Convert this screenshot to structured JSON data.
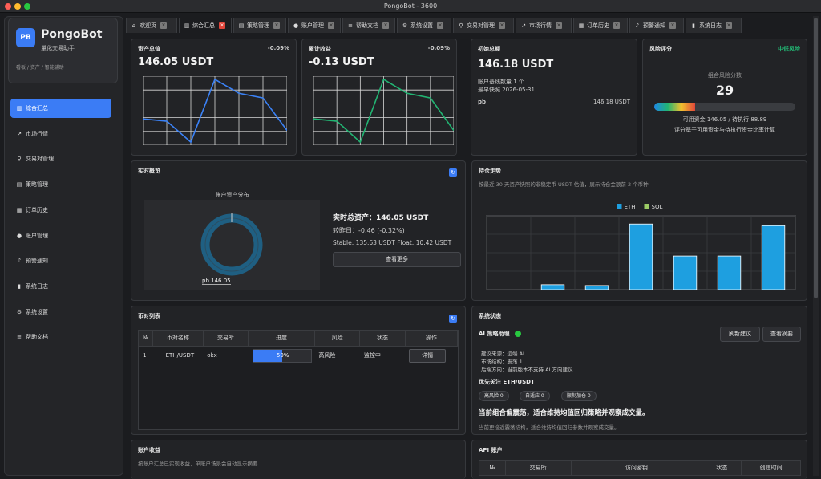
{
  "window": {
    "title": "PongoBot - 3600"
  },
  "brand": {
    "logo": "PB",
    "name": "PongoBot",
    "subtitle": "量化交易助手",
    "tags": "看板 / 资产 / 智能辅助"
  },
  "sidebar": {
    "items": [
      {
        "label": "综合汇总",
        "icon": "chart-icon",
        "glyph": "▥",
        "active": true
      },
      {
        "label": "市场行情",
        "icon": "trend-icon",
        "glyph": "↗"
      },
      {
        "label": "交易对管理",
        "icon": "magnifier-icon",
        "glyph": "⚲"
      },
      {
        "label": "策略管理",
        "icon": "notepad-icon",
        "glyph": "▤"
      },
      {
        "label": "订单历史",
        "icon": "clipboard-icon",
        "glyph": "▦"
      },
      {
        "label": "账户管理",
        "icon": "user-icon",
        "glyph": "●"
      },
      {
        "label": "预警通知",
        "icon": "bell-icon",
        "glyph": "♪"
      },
      {
        "label": "系统日志",
        "icon": "book-icon",
        "glyph": "▮"
      },
      {
        "label": "系统设置",
        "icon": "gear-icon",
        "glyph": "⚙"
      },
      {
        "label": "帮助文档",
        "icon": "books-icon",
        "glyph": "≡"
      }
    ]
  },
  "tabs": [
    {
      "label": "欢迎页",
      "icon": "home-icon",
      "glyph": "⌂"
    },
    {
      "label": "综合汇总",
      "icon": "chart-icon",
      "glyph": "▥",
      "active": true
    },
    {
      "label": "策略管理",
      "icon": "notepad-icon",
      "glyph": "▤"
    },
    {
      "label": "账户管理",
      "icon": "user-icon",
      "glyph": "●"
    },
    {
      "label": "帮助文档",
      "icon": "books-icon",
      "glyph": "≡"
    },
    {
      "label": "系统设置",
      "icon": "gear-icon",
      "glyph": "⚙"
    },
    {
      "label": "交易对管理",
      "icon": "magnifier-icon",
      "glyph": "⚲"
    },
    {
      "label": "市场行情",
      "icon": "trend-icon",
      "glyph": "↗"
    },
    {
      "label": "订单历史",
      "icon": "clipboard-icon",
      "glyph": "▦"
    },
    {
      "label": "预警通知",
      "icon": "bell-icon",
      "glyph": "♪"
    },
    {
      "label": "系统日志",
      "icon": "book-icon",
      "glyph": "▮"
    }
  ],
  "asset_card": {
    "title": "资产总值",
    "change": "-0.09%",
    "value": "146.05 USDT"
  },
  "pnl_card": {
    "title": "累计收益",
    "change": "-0.09%",
    "value": "-0.13 USDT"
  },
  "initial_card": {
    "title": "初始总额",
    "value": "146.18 USDT",
    "line1": "账户基线数量 1 个",
    "line2": "最早快照 2026-05-31",
    "account": "pb",
    "account_value": "146.18 USDT"
  },
  "risk_card": {
    "title": "风险评分",
    "level": "中低风险",
    "score_label": "组合风险分数",
    "score": "29",
    "score_pct": 29,
    "line1": "可用资金 146.05 / 待执行 88.89",
    "line2": "评分基于可用资金与待执行资金比率计算"
  },
  "realtime": {
    "title": "实时概览",
    "donut_title": "账户资产分布",
    "donut_label": "pb 146.05",
    "total_label": "实时总资产：",
    "total_value": "146.05 USDT",
    "prev_label": "较昨日：",
    "prev_value": "-0.46 (-0.32%)",
    "stable_line": "Stable: 135.63 USDT   Float: 10.42 USDT",
    "more_button": "查看更多"
  },
  "holdings": {
    "title": "持仓走势",
    "subtitle": "按最近 30 天资产快照的非稳定币 USDT 估值，展示持仓金额前 2 个币种"
  },
  "pairs": {
    "title": "币对列表",
    "columns": [
      "№",
      "币对名称",
      "交易所",
      "进度",
      "风险",
      "状态",
      "操作"
    ],
    "rows": [
      {
        "no": "1",
        "pair": "ETH/USDT",
        "exchange": "okx",
        "progress": "50%",
        "progress_value": 50,
        "risk": "高风险",
        "status": "监控中",
        "action": "详情"
      }
    ]
  },
  "system": {
    "title": "系统状态",
    "ai_label": "AI 策略助理",
    "refresh_button": "刷新建议",
    "summary_button": "查看摘要",
    "lines": [
      "建议来源：远端 AI",
      "市场结构：震荡 1",
      "后端方向：当前版本不支持 AI 方向建议"
    ],
    "focus": "优先关注 ETH/USDT",
    "pills": [
      "高风险 0",
      "自适应 0",
      "限制加仓 0"
    ],
    "headline": "当前组合偏震荡，适合维持均值回归策略并观察成交量。",
    "detail": "当前更接近震荡结构，适合维持均值回归参数并观察成交量。"
  },
  "account_income": {
    "title": "账户收益",
    "subtitle": "按账户汇总已实现收益，单账户场景会自动显示摘要"
  },
  "api": {
    "title": "API 账户",
    "columns": [
      "№",
      "交易所",
      "访问密钥",
      "状态",
      "创建时间"
    ]
  },
  "chart_data": [
    {
      "type": "line",
      "title": "",
      "x": [
        1,
        2,
        3,
        4,
        5,
        6,
        7
      ],
      "series": [
        {
          "values": [
            146.1,
            146.09,
            146.0,
            146.27,
            146.21,
            146.19,
            146.05
          ]
        }
      ],
      "color": "#3b82f6",
      "grid": true
    },
    {
      "type": "line",
      "title": "",
      "x": [
        1,
        2,
        3,
        4,
        5,
        6,
        7
      ],
      "series": [
        {
          "values": [
            -0.08,
            -0.09,
            -0.18,
            0.09,
            0.03,
            0.01,
            -0.13
          ]
        }
      ],
      "color": "#22b573",
      "grid": true
    },
    {
      "type": "bar",
      "title": "",
      "categories": [
        "1",
        "2",
        "3",
        "4",
        "5",
        "6",
        "7"
      ],
      "series": [
        {
          "name": "ETH",
          "values": [
            0,
            6,
            5,
            80,
            41,
            41,
            78
          ]
        },
        {
          "name": "SOL",
          "values": [
            0,
            0,
            0,
            0,
            0,
            0,
            0
          ]
        }
      ],
      "colors": {
        "ETH": "#1e9fe0",
        "SOL": "#9ccc65"
      },
      "legend": "top-center",
      "ylim": [
        0,
        90
      ],
      "grid": true
    }
  ]
}
